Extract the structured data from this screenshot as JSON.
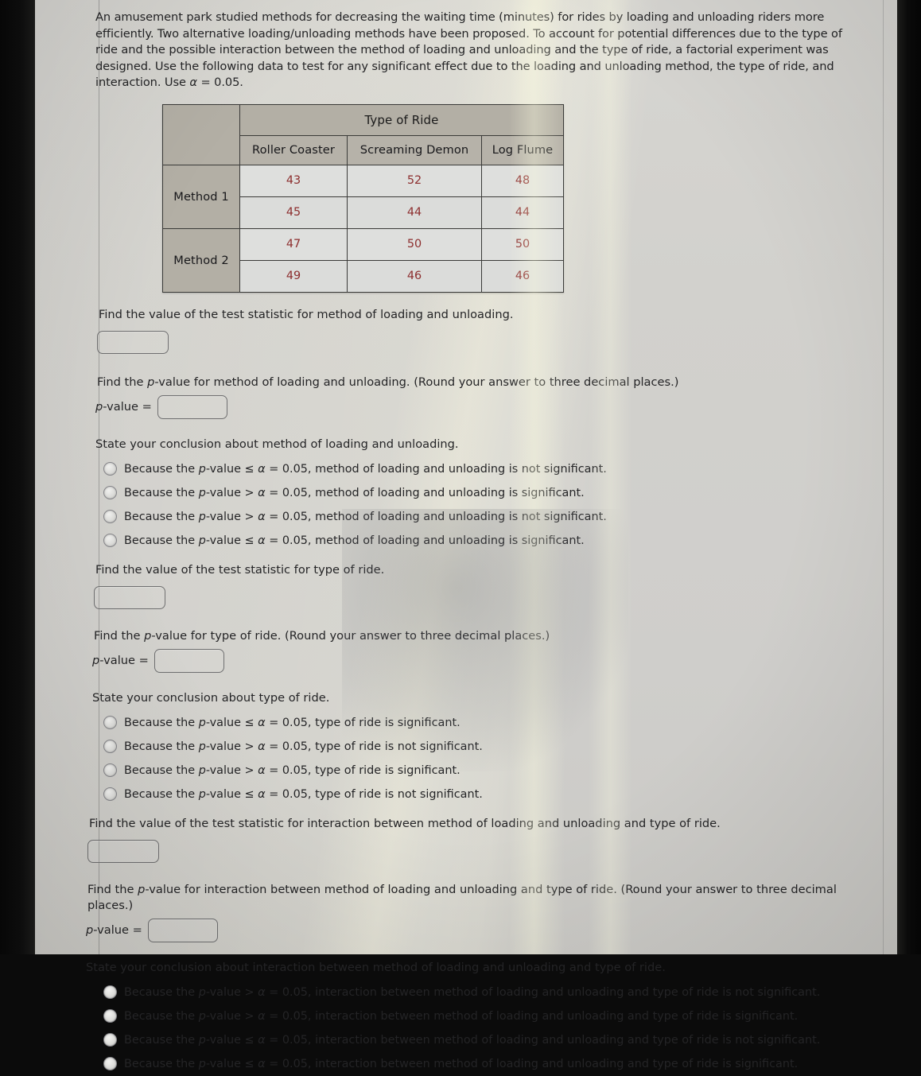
{
  "problem": {
    "intro": "An amusement park studied methods for decreasing the waiting time (minutes) for rides by loading and unloading riders more efficiently. Two alternative loading/unloading methods have been proposed. To account for potential differences due to the type of ride and the possible interaction between the method of loading and unloading and the type of ride, a factorial experiment was designed. Use the following data to test for any significant effect due to the loading and unloading method, the type of ride, and interaction. Use α = 0.05."
  },
  "table": {
    "corner_label": "",
    "span_header": "Type of Ride",
    "columns": [
      "Roller Coaster",
      "Screaming Demon",
      "Log Flume"
    ],
    "rows": [
      {
        "label": "Method 1",
        "values": [
          [
            "43",
            "52",
            "48"
          ],
          [
            "45",
            "44",
            "44"
          ]
        ]
      },
      {
        "label": "Method 2",
        "values": [
          [
            "47",
            "50",
            "50"
          ],
          [
            "49",
            "46",
            "46"
          ]
        ]
      }
    ],
    "header_bg": "#b3afa5",
    "cell_bg": "#dedfdd",
    "value_color": "#8c2d2d"
  },
  "sections": [
    {
      "id": "method",
      "statistic_prompt": "Find the value of the test statistic for method of loading and unloading.",
      "statistic_value": "",
      "pvalue_prompt": "Find the p-value for method of loading and unloading. (Round your answer to three decimal places.)",
      "pvalue_label": "p-value =",
      "pvalue_value": "",
      "conclusion_prompt": "State your conclusion about method of loading and unloading.",
      "options": [
        "Because the p-value ≤ α = 0.05, method of loading and unloading is not significant.",
        "Because the p-value > α = 0.05, method of loading and unloading is significant.",
        "Because the p-value > α = 0.05, method of loading and unloading is not significant.",
        "Because the p-value ≤ α = 0.05, method of loading and unloading is significant."
      ]
    },
    {
      "id": "ride",
      "statistic_prompt": "Find the value of the test statistic for type of ride.",
      "statistic_value": "",
      "pvalue_prompt": "Find the p-value for type of ride. (Round your answer to three decimal places.)",
      "pvalue_label": "p-value =",
      "pvalue_value": "",
      "conclusion_prompt": "State your conclusion about type of ride.",
      "options": [
        "Because the p-value ≤ α = 0.05, type of ride is significant.",
        "Because the p-value > α = 0.05, type of ride is not significant.",
        "Because the p-value > α = 0.05, type of ride is significant.",
        "Because the p-value ≤ α = 0.05, type of ride is not significant."
      ]
    },
    {
      "id": "interaction",
      "statistic_prompt": "Find the value of the test statistic for interaction between method of loading and unloading and type of ride.",
      "statistic_value": "",
      "pvalue_prompt": "Find the p-value for interaction between method of loading and unloading and type of ride. (Round your answer to three decimal places.)",
      "pvalue_label": "p-value =",
      "pvalue_value": "",
      "conclusion_prompt": "State your conclusion about interaction between method of loading and unloading and type of ride.",
      "options": [
        "Because the p-value > α = 0.05, interaction between method of loading and unloading and type of ride is not significant.",
        "Because the p-value > α = 0.05, interaction between method of loading and unloading and type of ride is significant.",
        "Because the p-value ≤ α = 0.05, interaction between method of loading and unloading and type of ride is not significant.",
        "Because the p-value ≤ α = 0.05, interaction between method of loading and unloading and type of ride is significant."
      ]
    }
  ]
}
